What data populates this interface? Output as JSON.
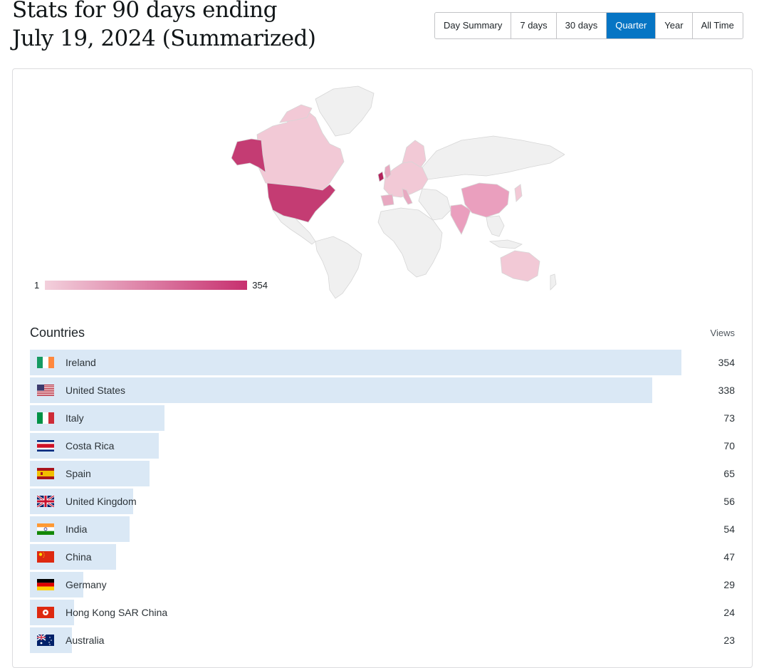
{
  "header": {
    "title_line1": "Stats for 90 days ending",
    "title_line2": "July 19, 2024 (Summarized)"
  },
  "period_tabs": [
    {
      "label": "Day Summary",
      "active": false
    },
    {
      "label": "7 days",
      "active": false
    },
    {
      "label": "30 days",
      "active": false
    },
    {
      "label": "Quarter",
      "active": true
    },
    {
      "label": "Year",
      "active": false
    },
    {
      "label": "All Time",
      "active": false
    }
  ],
  "map_legend": {
    "min": "1",
    "max": "354",
    "color_low": "#f3d0dc",
    "color_high": "#c7306f"
  },
  "countries": {
    "title": "Countries",
    "views_header": "Views",
    "max_views": 354,
    "rows": [
      {
        "name": "Ireland",
        "views": "354",
        "flag": "ireland-flag"
      },
      {
        "name": "United States",
        "views": "338",
        "flag": "united-states-flag"
      },
      {
        "name": "Italy",
        "views": "73",
        "flag": "italy-flag"
      },
      {
        "name": "Costa Rica",
        "views": "70",
        "flag": "costa-rica-flag"
      },
      {
        "name": "Spain",
        "views": "65",
        "flag": "spain-flag"
      },
      {
        "name": "United Kingdom",
        "views": "56",
        "flag": "united-kingdom-flag"
      },
      {
        "name": "India",
        "views": "54",
        "flag": "india-flag"
      },
      {
        "name": "China",
        "views": "47",
        "flag": "china-flag"
      },
      {
        "name": "Germany",
        "views": "29",
        "flag": "germany-flag"
      },
      {
        "name": "Hong Kong SAR China",
        "views": "24",
        "flag": "hong-kong-flag"
      },
      {
        "name": "Australia",
        "views": "23",
        "flag": "australia-flag"
      }
    ]
  },
  "colors": {
    "accent": "#0675c4",
    "bar": "#dae8f5",
    "map_land": "#f0f0f0"
  }
}
